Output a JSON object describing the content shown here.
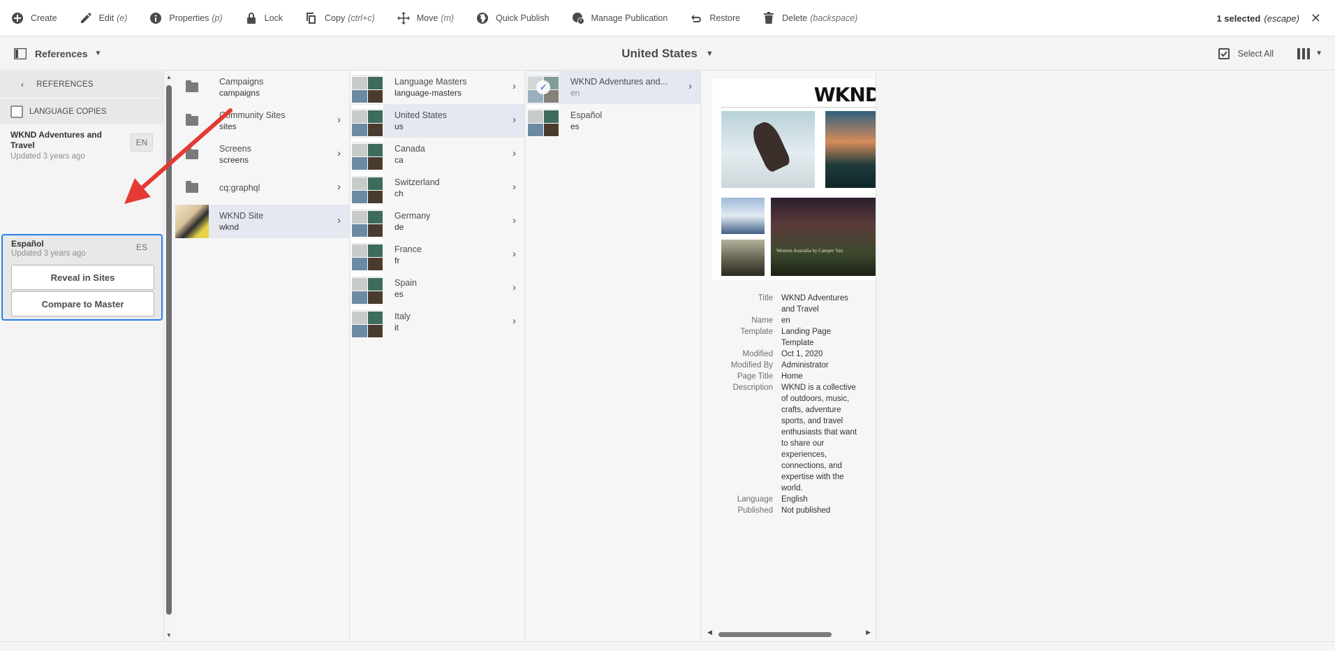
{
  "toolbar": {
    "create": "Create",
    "edit": "Edit",
    "edit_hint": "(e)",
    "properties": "Properties",
    "properties_hint": "(p)",
    "lock": "Lock",
    "copy": "Copy",
    "copy_hint": "(ctrl+c)",
    "move": "Move",
    "move_hint": "(m)",
    "quick_publish": "Quick Publish",
    "manage_publication": "Manage Publication",
    "restore": "Restore",
    "delete": "Delete",
    "delete_hint": "(backspace)",
    "selected": "1 selected",
    "escape": "(escape)"
  },
  "subbar": {
    "rail_label": "References",
    "title": "United States",
    "select_all": "Select All"
  },
  "rail": {
    "header": "REFERENCES",
    "section": "LANGUAGE COPIES",
    "items": [
      {
        "title": "WKND Adventures and Travel",
        "updated": "Updated 3 years ago",
        "badge": "EN"
      }
    ],
    "active": {
      "title": "Español",
      "updated": "Updated 3 years ago",
      "badge": "ES",
      "reveal": "Reveal in Sites",
      "compare": "Compare to Master"
    }
  },
  "columns": {
    "col1": [
      {
        "name": "Campaigns",
        "path": "campaigns"
      },
      {
        "name": "Community Sites",
        "path": "sites"
      },
      {
        "name": "Screens",
        "path": "screens"
      },
      {
        "name": "cq:graphql",
        "path": ""
      },
      {
        "name": "WKND Site",
        "path": "wknd"
      }
    ],
    "col2": [
      {
        "name": "Language Masters",
        "path": "language-masters"
      },
      {
        "name": "United States",
        "path": "us"
      },
      {
        "name": "Canada",
        "path": "ca"
      },
      {
        "name": "Switzerland",
        "path": "ch"
      },
      {
        "name": "Germany",
        "path": "de"
      },
      {
        "name": "France",
        "path": "fr"
      },
      {
        "name": "Spain",
        "path": "es"
      },
      {
        "name": "Italy",
        "path": "it"
      }
    ],
    "col3": [
      {
        "name": "WKND Adventures and...",
        "path": "en"
      },
      {
        "name": "Español",
        "path": "es"
      }
    ]
  },
  "detail": {
    "logo": "WKND",
    "caption": "Western Australia by Camper Van",
    "props": [
      {
        "k": "Title",
        "v": "WKND Adventures and Travel"
      },
      {
        "k": "Name",
        "v": "en"
      },
      {
        "k": "Template",
        "v": "Landing Page Template"
      },
      {
        "k": "Modified",
        "v": "Oct 1, 2020"
      },
      {
        "k": "Modified By",
        "v": "Administrator"
      },
      {
        "k": "Page Title",
        "v": "Home"
      },
      {
        "k": "Description",
        "v": "WKND is a collective of outdoors, music, crafts, adventure sports, and travel enthusiasts that want to share our experiences, connections, and expertise with the world."
      },
      {
        "k": "Language",
        "v": "English"
      },
      {
        "k": "Published",
        "v": "Not published"
      }
    ]
  },
  "colors": {
    "accent": "#2680eb",
    "annotation": "#e53935"
  }
}
